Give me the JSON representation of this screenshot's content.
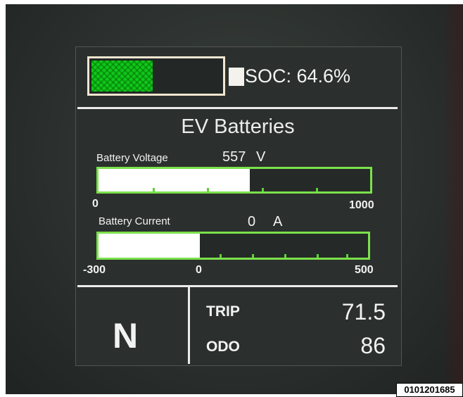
{
  "soc": {
    "text": "SOC: 64.6%",
    "percent": 64.6
  },
  "section_title": "EV Batteries",
  "voltage": {
    "label": "Battery Voltage",
    "value": "557",
    "unit": "V",
    "min_label": "0",
    "max_label": "1000",
    "min": 0,
    "max": 1000,
    "current": 557
  },
  "current": {
    "label": "Battery Current",
    "value": "0",
    "unit": "A",
    "min_label": "-300",
    "zero_label": "0",
    "max_label": "500",
    "min": -300,
    "max": 500,
    "current": 0
  },
  "gear": "N",
  "trip": {
    "label": "TRIP",
    "value": "71.5"
  },
  "odo": {
    "label": "ODO",
    "value": "86"
  },
  "reference_code": "0101201685",
  "colors": {
    "soc_fill": "#10c81a",
    "bar_border": "#7be14c",
    "screen_bg": "#2b302e",
    "text": "#f2f2f2"
  }
}
